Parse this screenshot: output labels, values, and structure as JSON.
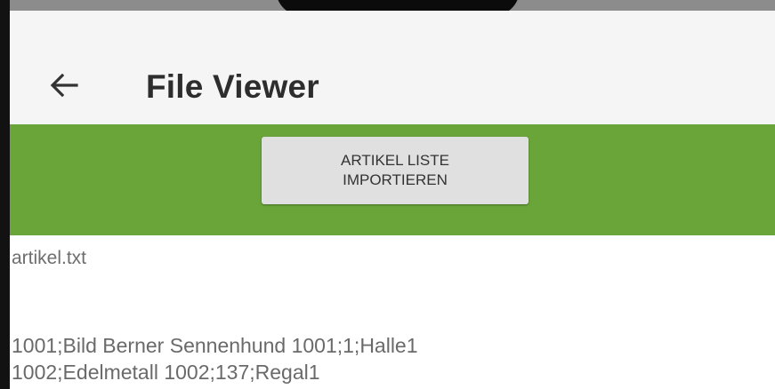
{
  "app_bar": {
    "title": "File Viewer",
    "back_icon": "arrow-left-icon"
  },
  "toolbar": {
    "import_button_line1": "ARTIKEL LISTE",
    "import_button_line2": "IMPORTIEREN"
  },
  "file": {
    "name": "artikel.txt",
    "lines": [
      "1001;Bild Berner Sennenhund 1001;1;Halle1",
      "1002;Edelmetall 1002;137;Regal1"
    ]
  },
  "colors": {
    "app_bar_bg": "#f5f5f5",
    "accent_green": "#6aa53a",
    "button_bg": "#e0e0e0"
  }
}
